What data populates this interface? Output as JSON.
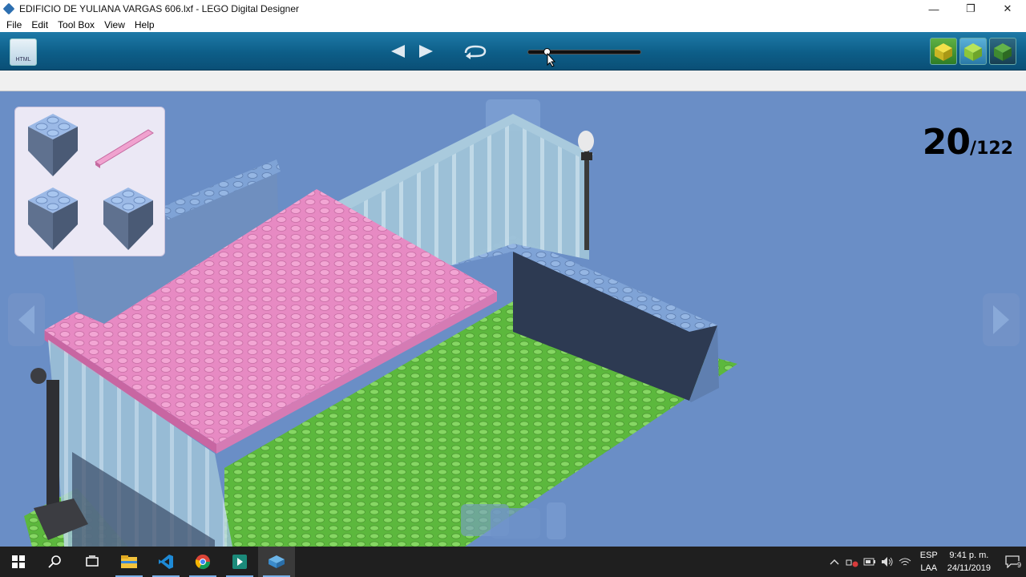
{
  "window": {
    "title": "EDIFICIO DE YULIANA VARGAS 606.lxf - LEGO Digital Designer",
    "minimize": "—",
    "restore": "❐",
    "close": "✕"
  },
  "menu": [
    "File",
    "Edit",
    "Tool Box",
    "View",
    "Help"
  ],
  "toolbar": {
    "html_label": "HTML",
    "prev_icon": "prev-step-icon",
    "next_icon": "next-step-icon",
    "rotate_icon": "rotate-view-icon",
    "step_slider_fraction": 0.17
  },
  "viewer": {
    "current_step": "20",
    "total_steps": "/122"
  },
  "colors": {
    "toolbar": "#0d5e88",
    "viewport": "#6a8ec6",
    "brick_blue": "#7fa3d6",
    "plate_pink": "#e988c4",
    "plate_green": "#6cc04a"
  },
  "taskbar": {
    "apps": [
      "start-icon",
      "search-icon",
      "task-view-icon",
      "file-explorer-icon",
      "vscode-icon",
      "chrome-icon",
      "app-icon",
      "lego-designer-icon"
    ],
    "language_top": "ESP",
    "language_bottom": "LAA",
    "time": "9:41 p. m.",
    "date": "24/11/2019",
    "notifications": "9"
  }
}
